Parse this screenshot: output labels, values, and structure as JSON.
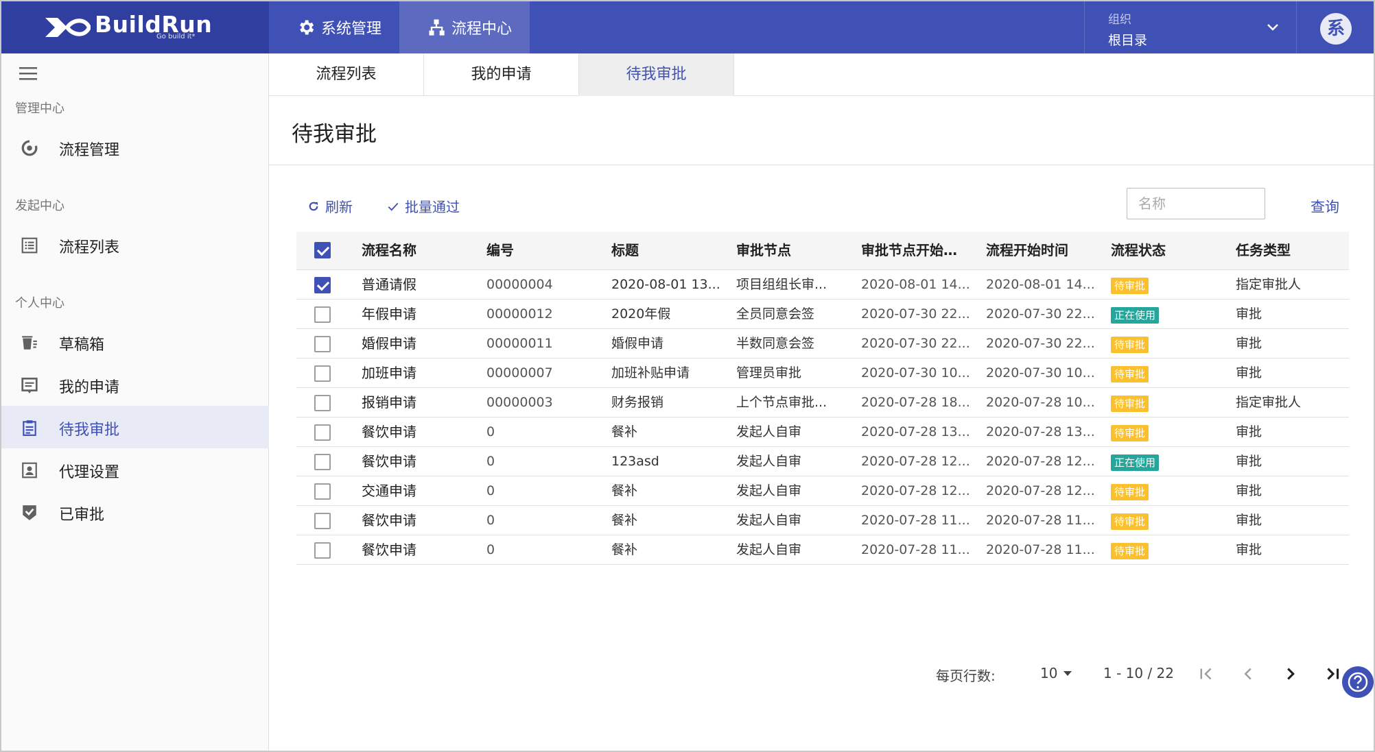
{
  "brand": {
    "name": "BuildRun",
    "tagline": "Go build it*"
  },
  "topnav": [
    {
      "label": "系统管理",
      "icon": "gear-icon"
    },
    {
      "label": "流程中心",
      "icon": "sitemap-icon",
      "active": true
    }
  ],
  "org": {
    "label": "组织",
    "value": "根目录"
  },
  "avatar": {
    "text": "系"
  },
  "sidebar": {
    "sections": [
      {
        "label": "管理中心"
      },
      {
        "label": "发起中心"
      },
      {
        "label": "个人中心"
      }
    ],
    "items": [
      {
        "label": "流程管理",
        "icon": "workflow-icon"
      },
      {
        "label": "流程列表",
        "icon": "list-icon"
      },
      {
        "label": "草稿箱",
        "icon": "drafts-icon"
      },
      {
        "label": "我的申请",
        "icon": "application-icon"
      },
      {
        "label": "待我审批",
        "icon": "clipboard-icon",
        "active": true
      },
      {
        "label": "代理设置",
        "icon": "contact-icon"
      },
      {
        "label": "已审批",
        "icon": "shield-check-icon"
      }
    ]
  },
  "subtabs": [
    {
      "label": "流程列表"
    },
    {
      "label": "我的申请"
    },
    {
      "label": "待我审批",
      "active": true
    }
  ],
  "page": {
    "title": "待我审批"
  },
  "toolbar": {
    "refresh_label": "刷新",
    "batch_label": "批量通过",
    "search_placeholder": "名称",
    "query_label": "查询"
  },
  "table": {
    "headers": [
      "流程名称",
      "编号",
      "标题",
      "审批节点",
      "审批节点开始…",
      "流程开始时间",
      "流程状态",
      "任务类型"
    ],
    "header_checked": true,
    "rows": [
      {
        "checked": true,
        "name": "普通请假",
        "no": "00000004",
        "title": "2020-08-01 13...",
        "node": "项目组组长审...",
        "node_start": "2020-08-01 14...",
        "start": "2020-08-01 14...",
        "status": "待审批",
        "status_type": "pending",
        "type": "指定审批人"
      },
      {
        "checked": false,
        "name": "年假申请",
        "no": "00000012",
        "title": "2020年假",
        "node": "全员同意会签",
        "node_start": "2020-07-30 22...",
        "start": "2020-07-30 22...",
        "status": "正在使用",
        "status_type": "inuse",
        "type": "审批"
      },
      {
        "checked": false,
        "name": "婚假申请",
        "no": "00000011",
        "title": "婚假申请",
        "node": "半数同意会签",
        "node_start": "2020-07-30 22...",
        "start": "2020-07-30 22...",
        "status": "待审批",
        "status_type": "pending",
        "type": "审批"
      },
      {
        "checked": false,
        "name": "加班申请",
        "no": "00000007",
        "title": "加班补贴申请",
        "node": "管理员审批",
        "node_start": "2020-07-30 10...",
        "start": "2020-07-30 10...",
        "status": "待审批",
        "status_type": "pending",
        "type": "审批"
      },
      {
        "checked": false,
        "name": "报销申请",
        "no": "00000003",
        "title": "财务报销",
        "node": "上个节点审批...",
        "node_start": "2020-07-28 18...",
        "start": "2020-07-28 10...",
        "status": "待审批",
        "status_type": "pending",
        "type": "指定审批人"
      },
      {
        "checked": false,
        "name": "餐饮申请",
        "no": "0",
        "title": "餐补",
        "node": "发起人自审",
        "node_start": "2020-07-28 13...",
        "start": "2020-07-28 13...",
        "status": "待审批",
        "status_type": "pending",
        "type": "审批"
      },
      {
        "checked": false,
        "name": "餐饮申请",
        "no": "0",
        "title": "123asd",
        "node": "发起人自审",
        "node_start": "2020-07-28 12...",
        "start": "2020-07-28 12...",
        "status": "正在使用",
        "status_type": "inuse",
        "type": "审批"
      },
      {
        "checked": false,
        "name": "交通申请",
        "no": "0",
        "title": "餐补",
        "node": "发起人自审",
        "node_start": "2020-07-28 12...",
        "start": "2020-07-28 12...",
        "status": "待审批",
        "status_type": "pending",
        "type": "审批"
      },
      {
        "checked": false,
        "name": "餐饮申请",
        "no": "0",
        "title": "餐补",
        "node": "发起人自审",
        "node_start": "2020-07-28 11...",
        "start": "2020-07-28 11...",
        "status": "待审批",
        "status_type": "pending",
        "type": "审批"
      },
      {
        "checked": false,
        "name": "餐饮申请",
        "no": "0",
        "title": "餐补",
        "node": "发起人自审",
        "node_start": "2020-07-28 11...",
        "start": "2020-07-28 11...",
        "status": "待审批",
        "status_type": "pending",
        "type": "审批"
      }
    ]
  },
  "pagination": {
    "rows_label": "每页行数:",
    "rows_per_page": "10",
    "range": "1 - 10 / 22"
  },
  "colors": {
    "primary": "#3f51b5",
    "primary_dark": "#303f9f",
    "pending": "#fbc02d",
    "inuse": "#26a69a"
  }
}
